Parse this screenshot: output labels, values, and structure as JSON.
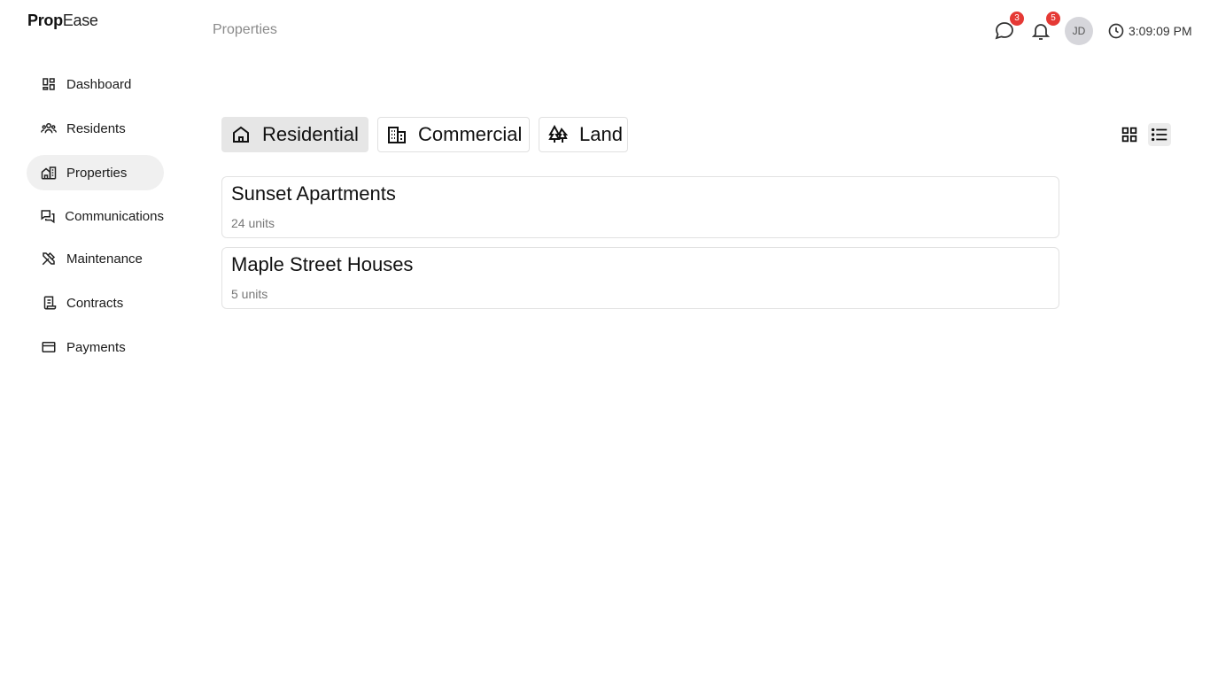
{
  "app": {
    "logo_bold": "Prop",
    "logo_light": "Ease"
  },
  "sidebar": {
    "items": [
      {
        "label": "Dashboard",
        "icon": "dashboard-icon"
      },
      {
        "label": "Residents",
        "icon": "people-icon"
      },
      {
        "label": "Properties",
        "icon": "building-icon",
        "active": true
      },
      {
        "label": "Communications",
        "icon": "chat-icon"
      },
      {
        "label": "Maintenance",
        "icon": "tools-icon"
      },
      {
        "label": "Contracts",
        "icon": "contract-icon"
      },
      {
        "label": "Payments",
        "icon": "card-icon"
      }
    ]
  },
  "header": {
    "title": "Properties",
    "messages_badge": "3",
    "notifications_badge": "5",
    "avatar_initials": "JD",
    "time": "3:09:09 PM"
  },
  "tabs": [
    {
      "label": "Residential",
      "icon": "house-icon",
      "active": true
    },
    {
      "label": "Commercial",
      "icon": "office-building-icon"
    },
    {
      "label": "Land",
      "icon": "trees-icon"
    }
  ],
  "view": {
    "grid_icon": "grid-view-icon",
    "list_icon": "list-view-icon",
    "active": "list"
  },
  "properties": [
    {
      "name": "Sunset Apartments",
      "units": "24 units"
    },
    {
      "name": "Maple Street Houses",
      "units": "5 units"
    }
  ],
  "colors": {
    "badge": "#e53935",
    "active_nav": "#f0f0f0",
    "active_tab": "#e6e6e6"
  }
}
